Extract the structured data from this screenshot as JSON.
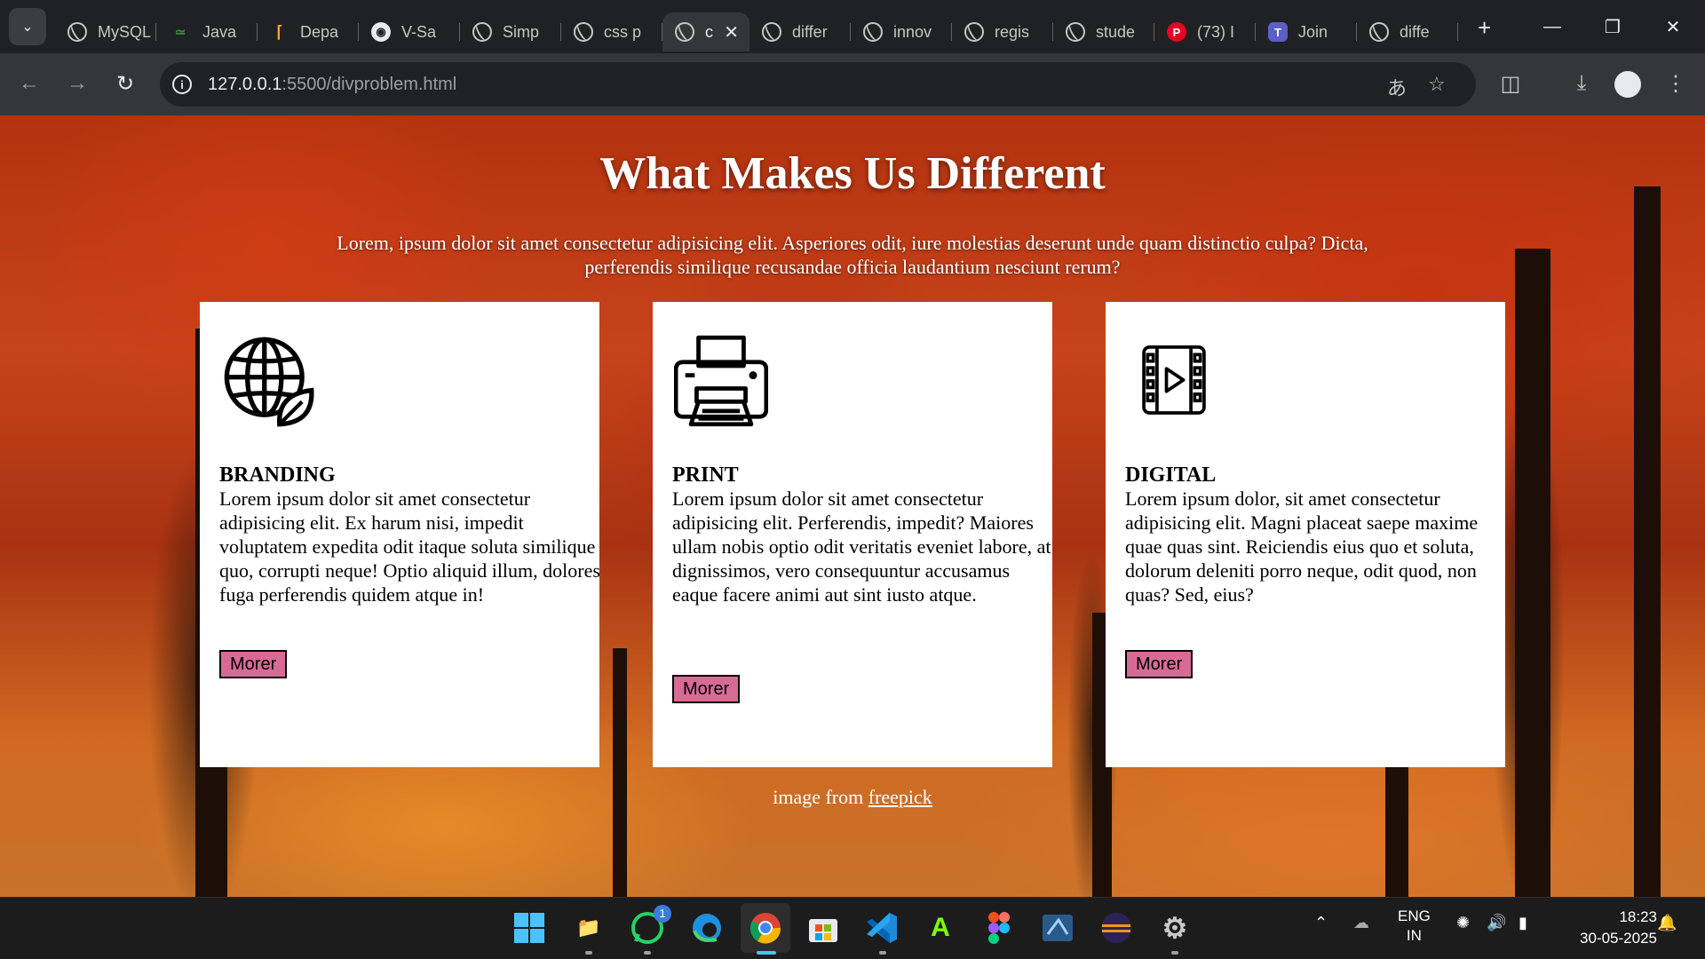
{
  "browser": {
    "tabs": [
      {
        "title": "MySQL",
        "favicon": "globe-icon"
      },
      {
        "title": "Java",
        "favicon": "gfg-icon"
      },
      {
        "title": "Depa",
        "favicon": "depa-icon"
      },
      {
        "title": "V-Sa",
        "favicon": "github-icon"
      },
      {
        "title": "Simp",
        "favicon": "globe-icon"
      },
      {
        "title": "css p",
        "favicon": "globe-icon"
      },
      {
        "title": "c",
        "favicon": "globe-icon",
        "active": true
      },
      {
        "title": "differ",
        "favicon": "globe-icon"
      },
      {
        "title": "innov",
        "favicon": "globe-icon"
      },
      {
        "title": "regis",
        "favicon": "globe-icon"
      },
      {
        "title": "stude",
        "favicon": "globe-icon"
      },
      {
        "title": "(73) I",
        "favicon": "pinterest-icon"
      },
      {
        "title": "Join",
        "favicon": "teams-icon"
      },
      {
        "title": "diffe",
        "favicon": "globe-icon"
      }
    ],
    "url_host": "127.0.0.1",
    "url_rest": ":5500/divproblem.html"
  },
  "page": {
    "heading": "What Makes Us Different",
    "intro": "Lorem, ipsum dolor sit amet consectetur adipisicing elit. Asperiores odit, iure molestias deserunt unde quam distinctio culpa? Dicta, perferendis similique recusandae officia laudantium nesciunt rerum?",
    "cards": [
      {
        "icon": "globe-leaf-icon",
        "title": "BRANDING",
        "text": "Lorem ipsum dolor sit amet consectetur adipisicing elit. Ex harum nisi, impedit voluptatem expedita odit itaque soluta similique quo, corrupti neque! Optio aliquid illum, dolores fuga perferendis quidem atque in!",
        "button": "Morer"
      },
      {
        "icon": "printer-icon",
        "title": "PRINT",
        "text": "Lorem ipsum dolor sit amet consectetur adipisicing elit. Perferendis, impedit? Maiores ullam nobis optio odit veritatis eveniet labore, at dignissimos, vero consequuntur accusamus eaque facere animi aut sint iusto atque.",
        "button": "Morer"
      },
      {
        "icon": "film-play-icon",
        "title": "DIGITAL",
        "text": "Lorem ipsum dolor, sit amet consectetur adipisicing elit. Magni placeat saepe maxime quae quas sint. Reiciendis eius quo et soluta, dolorum deleniti porro neque, odit quod, non quas? Sed, eius?",
        "button": "Morer"
      }
    ],
    "credit_prefix": "image from ",
    "credit_link": "freepick"
  },
  "taskbar": {
    "whatsapp_badge": "1",
    "lang_top": "ENG",
    "lang_bottom": "IN",
    "time": "18:23",
    "date": "30-05-2025"
  },
  "colors": {
    "button_bg": "#d86b95",
    "tab_bg": "#202124",
    "toolbar_bg": "#35363a"
  }
}
